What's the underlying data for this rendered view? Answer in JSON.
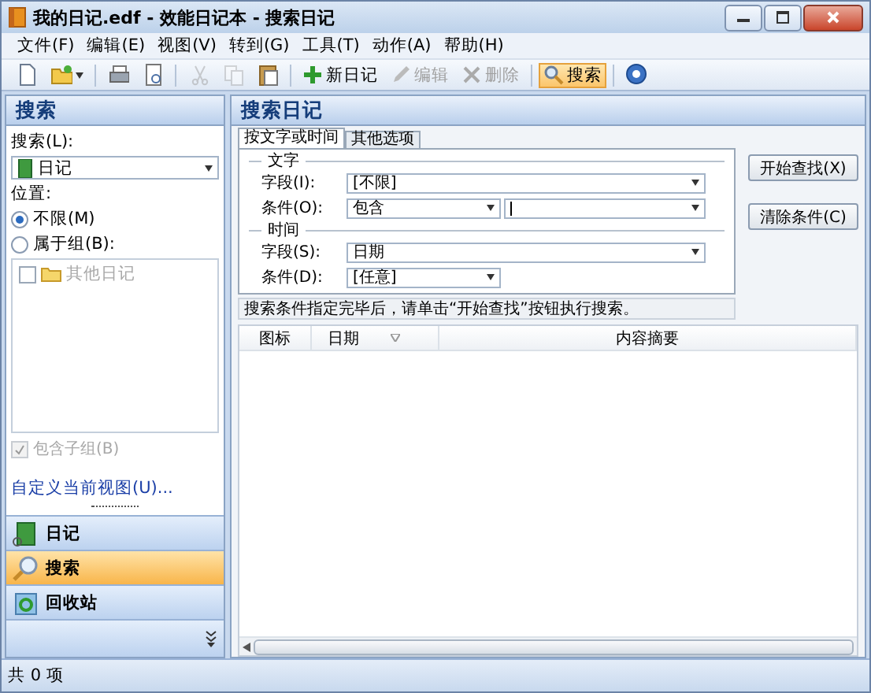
{
  "window": {
    "title": "我的日记.edf - 效能日记本 - 搜索日记"
  },
  "menu": [
    "文件(F)",
    "编辑(E)",
    "视图(V)",
    "转到(G)",
    "工具(T)",
    "动作(A)",
    "帮助(H)"
  ],
  "toolbar": [
    {
      "kind": "icon",
      "disabled": false
    },
    {
      "kind": "icon",
      "disabled": false,
      "dropdown": true
    },
    {
      "kind": "separator"
    },
    {
      "kind": "icon",
      "disabled": false
    },
    {
      "kind": "icon",
      "disabled": false
    },
    {
      "kind": "separator"
    },
    {
      "kind": "icon",
      "disabled": true
    },
    {
      "kind": "icon",
      "disabled": true
    },
    {
      "kind": "icon",
      "disabled": false
    },
    {
      "kind": "separator"
    },
    {
      "kind": "text",
      "label": "新日记",
      "disabled": false,
      "selected": false
    },
    {
      "kind": "text",
      "label": "编辑",
      "disabled": true,
      "selected": false
    },
    {
      "kind": "text",
      "label": "删除",
      "disabled": true,
      "selected": false
    },
    {
      "kind": "separator"
    },
    {
      "kind": "text",
      "label": "搜索",
      "disabled": false,
      "selected": true
    },
    {
      "kind": "separator"
    },
    {
      "kind": "icon",
      "disabled": false
    }
  ],
  "sidebar": {
    "title": "搜索",
    "search_label": "搜索(L):",
    "search_value": "日记",
    "location_label": "位置:",
    "radios": [
      {
        "label": "不限(M)",
        "selected": true
      },
      {
        "label": "属于组(B):",
        "selected": false
      }
    ],
    "groups": [
      {
        "label": "其他日记",
        "checked": false,
        "disabled": true
      }
    ],
    "include_subgroups": {
      "label": "包含子组(B)",
      "checked": true,
      "disabled": true
    },
    "customize_link": "自定义当前视图(U)...",
    "nav": [
      {
        "label": "日记",
        "selected": false
      },
      {
        "label": "搜索",
        "selected": true
      },
      {
        "label": "回收站",
        "selected": false
      }
    ]
  },
  "main": {
    "title": "搜索日记",
    "tabs": [
      {
        "label": "按文字或时间",
        "selected": true
      },
      {
        "label": "其他选项",
        "selected": false
      }
    ],
    "sections": [
      {
        "heading": "文字",
        "rows": [
          {
            "label": "字段(I):",
            "fields": [
              {
                "kind": "long",
                "value": "[不限]"
              }
            ]
          },
          {
            "label": "条件(O):",
            "fields": [
              {
                "kind": "short",
                "value": "包含"
              },
              {
                "kind": "rest",
                "caret": true
              }
            ]
          }
        ]
      },
      {
        "heading": "时间",
        "rows": [
          {
            "label": "字段(S):",
            "fields": [
              {
                "kind": "long",
                "value": "日期"
              }
            ]
          },
          {
            "label": "条件(D):",
            "fields": [
              {
                "kind": "short",
                "value": "[任意]"
              }
            ]
          }
        ]
      }
    ],
    "buttons": [
      "开始查找(X)",
      "清除条件(C)"
    ],
    "hint": "搜索条件指定完毕后，请单击“开始查找”按钮执行搜索。",
    "columns": [
      {
        "label": "图标",
        "sorted": false
      },
      {
        "label": "日期",
        "sorted": true
      },
      {
        "label": "内容摘要",
        "sorted": false
      }
    ]
  },
  "status_bar": "共 0 项"
}
